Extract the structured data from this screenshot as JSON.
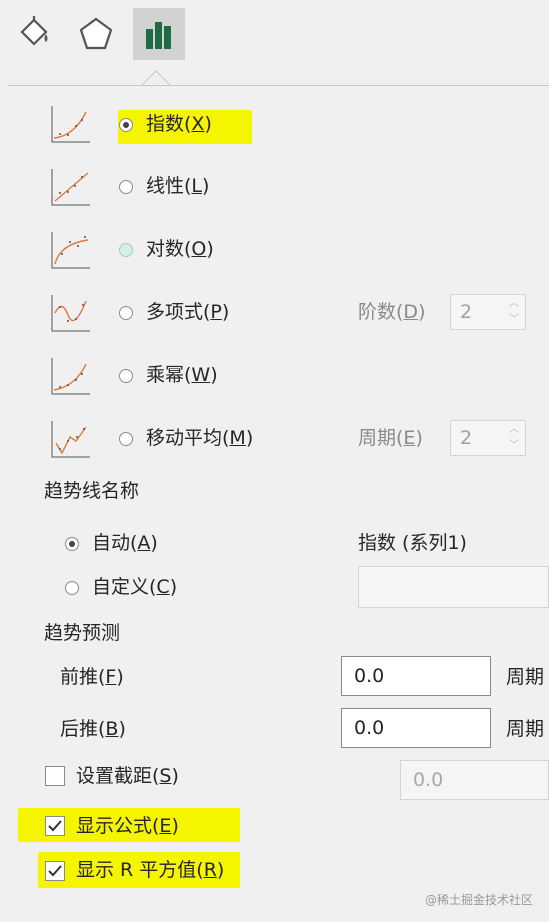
{
  "tabs": [
    {
      "name": "fill-line",
      "icon": "paint-bucket-icon"
    },
    {
      "name": "effects",
      "icon": "pentagon-icon"
    },
    {
      "name": "options",
      "icon": "bar-chart-icon",
      "active": true
    }
  ],
  "trend_types": [
    {
      "label": "指数(",
      "key": "X",
      "end": ")",
      "selected": true,
      "highlighted": true,
      "icon": "exponential-trend-icon"
    },
    {
      "label": "线性(",
      "key": "L",
      "end": ")",
      "icon": "linear-trend-icon"
    },
    {
      "label": "对数(",
      "key": "O",
      "end": ")",
      "icon": "logarithmic-trend-icon"
    },
    {
      "label": "多项式(",
      "key": "P",
      "end": ")",
      "icon": "polynomial-trend-icon"
    },
    {
      "label": "乘幂(",
      "key": "W",
      "end": ")",
      "icon": "power-trend-icon"
    },
    {
      "label": "移动平均(",
      "key": "M",
      "end": ")",
      "icon": "moving-average-trend-icon"
    }
  ],
  "order": {
    "label": "阶数(",
    "key": "D",
    "end": ")",
    "value": "2"
  },
  "period": {
    "label": "周期(",
    "key": "E",
    "end": ")",
    "value": "2"
  },
  "trend_name": {
    "heading": "趋势线名称",
    "auto": {
      "label": "自动(",
      "key": "A",
      "end": ")",
      "selected": true
    },
    "auto_value": "指数 (系列1)",
    "custom": {
      "label": "自定义(",
      "key": "C",
      "end": ")"
    }
  },
  "forecast": {
    "heading": "趋势预测",
    "forward": {
      "label": "前推(",
      "key": "F",
      "end": ")",
      "value": "0.0",
      "unit": "周期"
    },
    "backward": {
      "label": "后推(",
      "key": "B",
      "end": ")",
      "value": "0.0",
      "unit": "周期"
    }
  },
  "intercept": {
    "label": "设置截距(",
    "key": "S",
    "end": ")",
    "value": "0.0",
    "checked": false
  },
  "show_equation": {
    "label": "显示公式(",
    "key": "E",
    "end": ")",
    "checked": true
  },
  "show_r2": {
    "label": "显示 R 平方值(",
    "key": "R",
    "end": ")",
    "checked": true
  },
  "watermark": "@稀土掘金技术社区",
  "colors": {
    "highlight": "#f5f500",
    "trend_line": "#e07a3a"
  }
}
